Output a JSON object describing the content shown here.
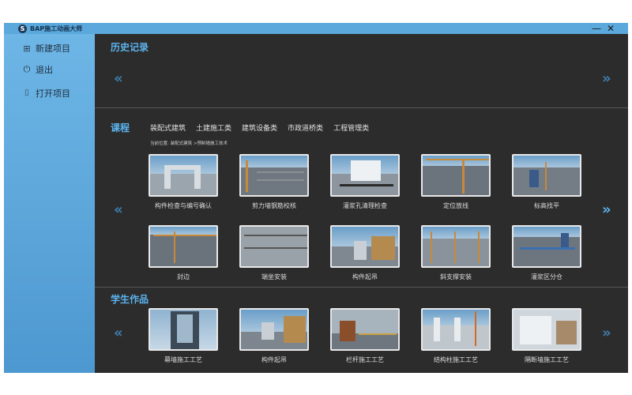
{
  "app": {
    "title": "BAP施工动画大师",
    "logo_letter": "S"
  },
  "window_controls": {
    "minimize": "—",
    "close": "✕"
  },
  "sidebar": {
    "items": [
      {
        "label": "新建项目",
        "icon": "plus-square-icon",
        "glyph": "⊞"
      },
      {
        "label": "退出",
        "icon": "power-icon",
        "glyph": "⏻"
      },
      {
        "label": "打开项目",
        "icon": "open-folder-icon",
        "glyph": "⌷"
      }
    ]
  },
  "history": {
    "title": "历史记录",
    "prev": "«",
    "next": "»"
  },
  "courses": {
    "title": "课程",
    "tabs": [
      "装配式建筑",
      "土建施工类",
      "建筑设备类",
      "市政道桥类",
      "工程管理类"
    ],
    "breadcrumb": "当前位置: 装配式建筑 >预制墙施工技术",
    "prev": "«",
    "next": "»",
    "row1": [
      "构件检查与编号确认",
      "剪力墙钢筋校核",
      "灌浆孔清理检查",
      "定位放线",
      "标高找平"
    ],
    "row2": [
      "封边",
      "端坐安装",
      "构件起吊",
      "斜支撑安装",
      "灌浆区分仓"
    ]
  },
  "student_works": {
    "title": "学生作品",
    "prev": "«",
    "next": "»",
    "items": [
      "幕墙施工工艺",
      "构件起吊",
      "栏杆施工工艺",
      "结构柱施工工艺",
      "隔断墙施工工艺"
    ]
  },
  "colors": {
    "accent": "#5bb4f0",
    "sidebar": "#5aa8dc",
    "background": "#2c2c2c"
  }
}
